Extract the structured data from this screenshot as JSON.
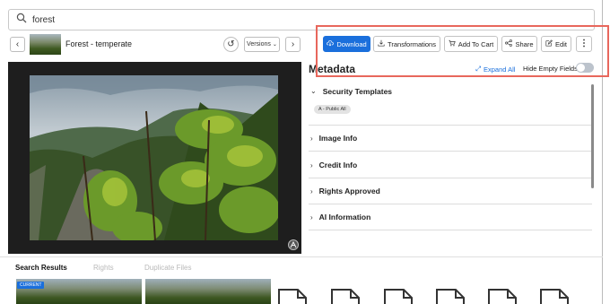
{
  "search": {
    "value": "forest"
  },
  "asset": {
    "title": "Forest - temperate",
    "versions_label": "Versions"
  },
  "toolbar": {
    "download": "Download",
    "transformations": "Transformations",
    "add_to_cart": "Add To Cart",
    "share": "Share",
    "edit": "Edit"
  },
  "metadata": {
    "title": "Metadata",
    "expand_all": "Expand All",
    "hide_empty": "Hide Empty Fields",
    "hide_empty_on": false,
    "sections": [
      {
        "label": "Security Templates",
        "expanded": true,
        "chip": "A - Public All"
      },
      {
        "label": "Image Info",
        "expanded": false
      },
      {
        "label": "Credit Info",
        "expanded": false
      },
      {
        "label": "Rights Approved",
        "expanded": false
      },
      {
        "label": "AI Information",
        "expanded": false
      }
    ]
  },
  "bottom_tabs": [
    {
      "label": "Search Results",
      "active": true
    },
    {
      "label": "Rights",
      "active": false
    },
    {
      "label": "Duplicate Files",
      "active": false
    }
  ],
  "results": {
    "current_badge": "CURRENT"
  },
  "colors": {
    "accent": "#1a6fdc",
    "highlight": "#e8675c"
  }
}
